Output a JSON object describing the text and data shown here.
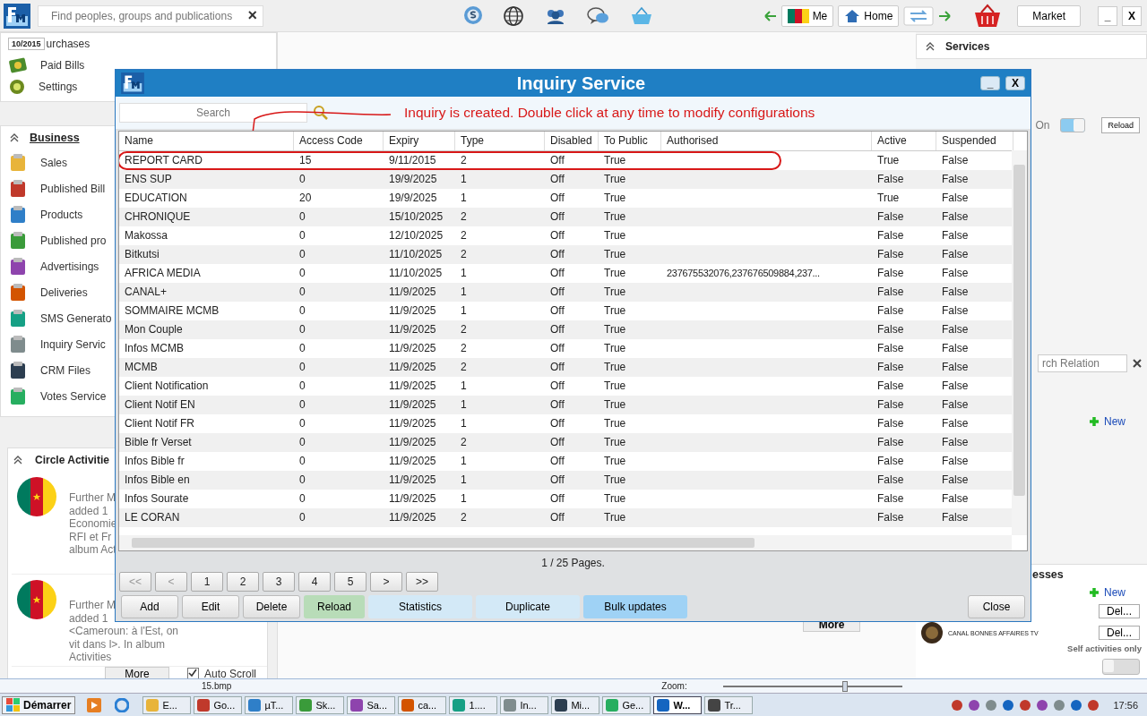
{
  "top_bar": {
    "search": {
      "placeholder": "Find peoples, groups and publications"
    },
    "clear": "×",
    "nav_buttons": [
      {
        "label": "Me"
      },
      {
        "label": "Home"
      }
    ],
    "market": "Market",
    "window_buttons": [
      "_",
      "X"
    ]
  },
  "left_panel": {
    "date_badge": "10/2015",
    "top_items": [
      "urchases",
      "Paid Bills",
      "Settings"
    ],
    "business": {
      "title": "Business",
      "items": [
        "Sales",
        "Published Bill",
        "Products",
        "Published pro",
        "Advertisings",
        "Deliveries",
        "SMS Generato",
        "Inquiry Servic",
        "CRM Files",
        "Votes Service"
      ]
    },
    "circle": {
      "title": "Circle Activitie",
      "posts": [
        {
          "lines": [
            "Further M",
            "added 1",
            "Economie",
            "RFI et Fr",
            "album Act"
          ]
        },
        {
          "lines": [
            "Further M",
            "added 1",
            "<Cameroun: à l'Est, on",
            "vit dans l>. In album",
            "Activities"
          ]
        }
      ],
      "more": "More",
      "auto_scroll": {
        "label": "Auto Scroll",
        "checked": true
      }
    }
  },
  "center": {
    "more": "More"
  },
  "right_panel": {
    "title": "Services",
    "toggle": {
      "label": "On",
      "on": true
    },
    "reload": "Reload",
    "relation_search": {
      "placeholder": "rch Relation"
    },
    "new_links": [
      "New",
      "New"
    ],
    "section_title": "esses",
    "delete_buttons": [
      "Del...",
      "Del..."
    ],
    "contact": "CANAL BONNES AFFAIRES TV",
    "self_activities": {
      "label": "Self activities only",
      "on": false
    }
  },
  "dialog": {
    "title": "Inquiry Service",
    "window_buttons": [
      "_",
      "X"
    ],
    "search": {
      "placeholder": "Search"
    },
    "annotation": "Inquiry is created. Double click at any time to modify configurations",
    "columns": [
      "Name",
      "Access Code",
      "Expiry",
      "Type",
      "Disabled",
      "To Public",
      "Authorised",
      "Active",
      "Suspended"
    ],
    "rows": [
      {
        "cells": [
          "REPORT CARD",
          "15",
          "9/11/2015",
          "2",
          "Off",
          "True",
          "",
          "True",
          "False"
        ],
        "circled": true
      },
      {
        "cells": [
          "ENS SUP",
          "0",
          "19/9/2025",
          "1",
          "Off",
          "True",
          "",
          "False",
          "False"
        ],
        "circled": false
      },
      {
        "cells": [
          "EDUCATION",
          "20",
          "19/9/2025",
          "1",
          "Off",
          "True",
          "",
          "True",
          "False"
        ],
        "circled": false
      },
      {
        "cells": [
          "CHRONIQUE",
          "0",
          "15/10/2025",
          "2",
          "Off",
          "True",
          "",
          "False",
          "False"
        ],
        "circled": false
      },
      {
        "cells": [
          "Makossa",
          "0",
          "12/10/2025",
          "2",
          "Off",
          "True",
          "",
          "False",
          "False"
        ],
        "circled": false
      },
      {
        "cells": [
          "Bitkutsi",
          "0",
          "11/10/2025",
          "2",
          "Off",
          "True",
          "",
          "False",
          "False"
        ],
        "circled": false
      },
      {
        "cells": [
          "AFRICA MEDIA",
          "0",
          "11/10/2025",
          "1",
          "Off",
          "True",
          "237675532076,237676509884,237...",
          "False",
          "False"
        ],
        "circled": false
      },
      {
        "cells": [
          "CANAL+",
          "0",
          "11/9/2025",
          "1",
          "Off",
          "True",
          "",
          "False",
          "False"
        ],
        "circled": false
      },
      {
        "cells": [
          "SOMMAIRE MCMB",
          "0",
          "11/9/2025",
          "1",
          "Off",
          "True",
          "",
          "False",
          "False"
        ],
        "circled": false
      },
      {
        "cells": [
          "Mon Couple",
          "0",
          "11/9/2025",
          "2",
          "Off",
          "True",
          "",
          "False",
          "False"
        ],
        "circled": false
      },
      {
        "cells": [
          "Infos MCMB",
          "0",
          "11/9/2025",
          "2",
          "Off",
          "True",
          "",
          "False",
          "False"
        ],
        "circled": false
      },
      {
        "cells": [
          "MCMB",
          "0",
          "11/9/2025",
          "2",
          "Off",
          "True",
          "",
          "False",
          "False"
        ],
        "circled": false
      },
      {
        "cells": [
          "Client Notification",
          "0",
          "11/9/2025",
          "1",
          "Off",
          "True",
          "",
          "False",
          "False"
        ],
        "circled": false
      },
      {
        "cells": [
          "Client Notif EN",
          "0",
          "11/9/2025",
          "1",
          "Off",
          "True",
          "",
          "False",
          "False"
        ],
        "circled": false
      },
      {
        "cells": [
          "Client Notif FR",
          "0",
          "11/9/2025",
          "1",
          "Off",
          "True",
          "",
          "False",
          "False"
        ],
        "circled": false
      },
      {
        "cells": [
          "Bible fr Verset",
          "0",
          "11/9/2025",
          "2",
          "Off",
          "True",
          "",
          "False",
          "False"
        ],
        "circled": false
      },
      {
        "cells": [
          "Infos Bible fr",
          "0",
          "11/9/2025",
          "1",
          "Off",
          "True",
          "",
          "False",
          "False"
        ],
        "circled": false
      },
      {
        "cells": [
          "Infos Bible en",
          "0",
          "11/9/2025",
          "1",
          "Off",
          "True",
          "",
          "False",
          "False"
        ],
        "circled": false
      },
      {
        "cells": [
          "Infos Sourate",
          "0",
          "11/9/2025",
          "1",
          "Off",
          "True",
          "",
          "False",
          "False"
        ],
        "circled": false
      },
      {
        "cells": [
          "LE CORAN",
          "0",
          "11/9/2025",
          "2",
          "Off",
          "True",
          "",
          "False",
          "False"
        ],
        "circled": false
      }
    ],
    "page_info": "1 / 25 Pages.",
    "pager": [
      {
        "label": "<<",
        "disabled": true
      },
      {
        "label": "<",
        "disabled": true
      },
      {
        "label": "1",
        "disabled": false
      },
      {
        "label": "2",
        "disabled": false
      },
      {
        "label": "3",
        "disabled": false
      },
      {
        "label": "4",
        "disabled": false
      },
      {
        "label": "5",
        "disabled": false
      },
      {
        "label": ">",
        "disabled": false
      },
      {
        "label": ">>",
        "disabled": false
      }
    ],
    "actions": [
      {
        "label": "Add",
        "kind": "plain"
      },
      {
        "label": "Edit",
        "kind": "plain"
      },
      {
        "label": "Delete",
        "kind": "plain"
      },
      {
        "label": "Reload",
        "kind": "green"
      },
      {
        "label": "Statistics",
        "kind": "light"
      },
      {
        "label": "Duplicate",
        "kind": "light"
      },
      {
        "label": "Bulk updates",
        "kind": "blue"
      }
    ],
    "close": "Close"
  },
  "status_bar": {
    "file": "15.bmp",
    "zoom": "Zoom:",
    "zoom_slider": {
      "level": 0.68
    }
  },
  "taskbar": {
    "start": "Démarrer",
    "items": [
      {
        "label": "E...",
        "selected": false
      },
      {
        "label": "Go...",
        "selected": false
      },
      {
        "label": "µT...",
        "selected": false
      },
      {
        "label": "Sk...",
        "selected": false
      },
      {
        "label": "Sa...",
        "selected": false
      },
      {
        "label": "ca...",
        "selected": false
      },
      {
        "label": "1....",
        "selected": false
      },
      {
        "label": "In...",
        "selected": false
      },
      {
        "label": "Mi...",
        "selected": false
      },
      {
        "label": "Ge...",
        "selected": false
      },
      {
        "label": "W...",
        "selected": true
      },
      {
        "label": "Tr...",
        "selected": false
      }
    ],
    "clock": "17:56"
  }
}
